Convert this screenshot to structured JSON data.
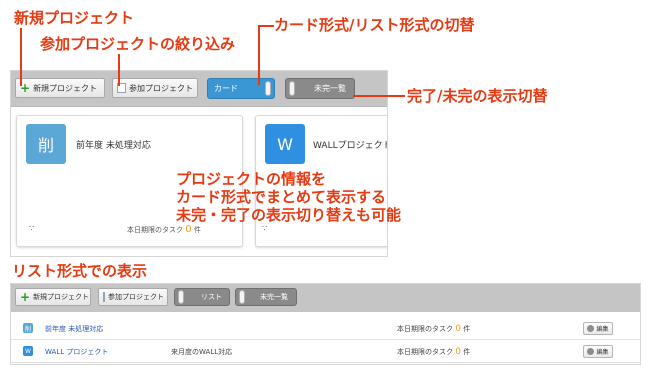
{
  "callouts": {
    "new_project": "新規プロジェクト",
    "join_project": "参加プロジェクトの絞り込み",
    "view_toggle": "カード形式/リスト形式の切替",
    "done_toggle": "完了/未完の表示切替",
    "center_line1": "プロジェクトの情報を",
    "center_line2": "カード形式でまとめて表示する",
    "center_line3": "未完・完了の表示切り替えも可能",
    "list_heading": "リスト形式での表示"
  },
  "toolbar": {
    "new_project": "新規プロジェクト",
    "join_project": "参加プロジェクト",
    "view_card": "カード",
    "done_incomplete": "未完一覧",
    "view_list": "リスト"
  },
  "cards": [
    {
      "avatar": "削",
      "title": "前年度 未処理対応",
      "footer": "本日期限のタスク",
      "count": "0",
      "unit": "件",
      "avatar_color": "#5ba7d6"
    },
    {
      "avatar": "W",
      "title": "WALLプロジェクト",
      "footer": "",
      "count": "",
      "unit": "",
      "avatar_color": "#2f8fe0"
    }
  ],
  "list_rows": [
    {
      "avatar": "削",
      "name": "前年度 未処理対応",
      "desc": "",
      "task_label": "本日期限のタスク",
      "count": "0",
      "unit": "件",
      "edit": "編集",
      "avatar_color": "#5ba7d6"
    },
    {
      "avatar": "W",
      "name": "WALL プロジェクト",
      "desc": "来月度のWALL対応",
      "task_label": "本日期限のタスク",
      "count": "0",
      "unit": "件",
      "edit": "編集",
      "avatar_color": "#2f8fe0"
    }
  ],
  "colors": {
    "accent": "#e53a12",
    "toggle_on": "#3b97d3",
    "count": "#f39a17"
  }
}
